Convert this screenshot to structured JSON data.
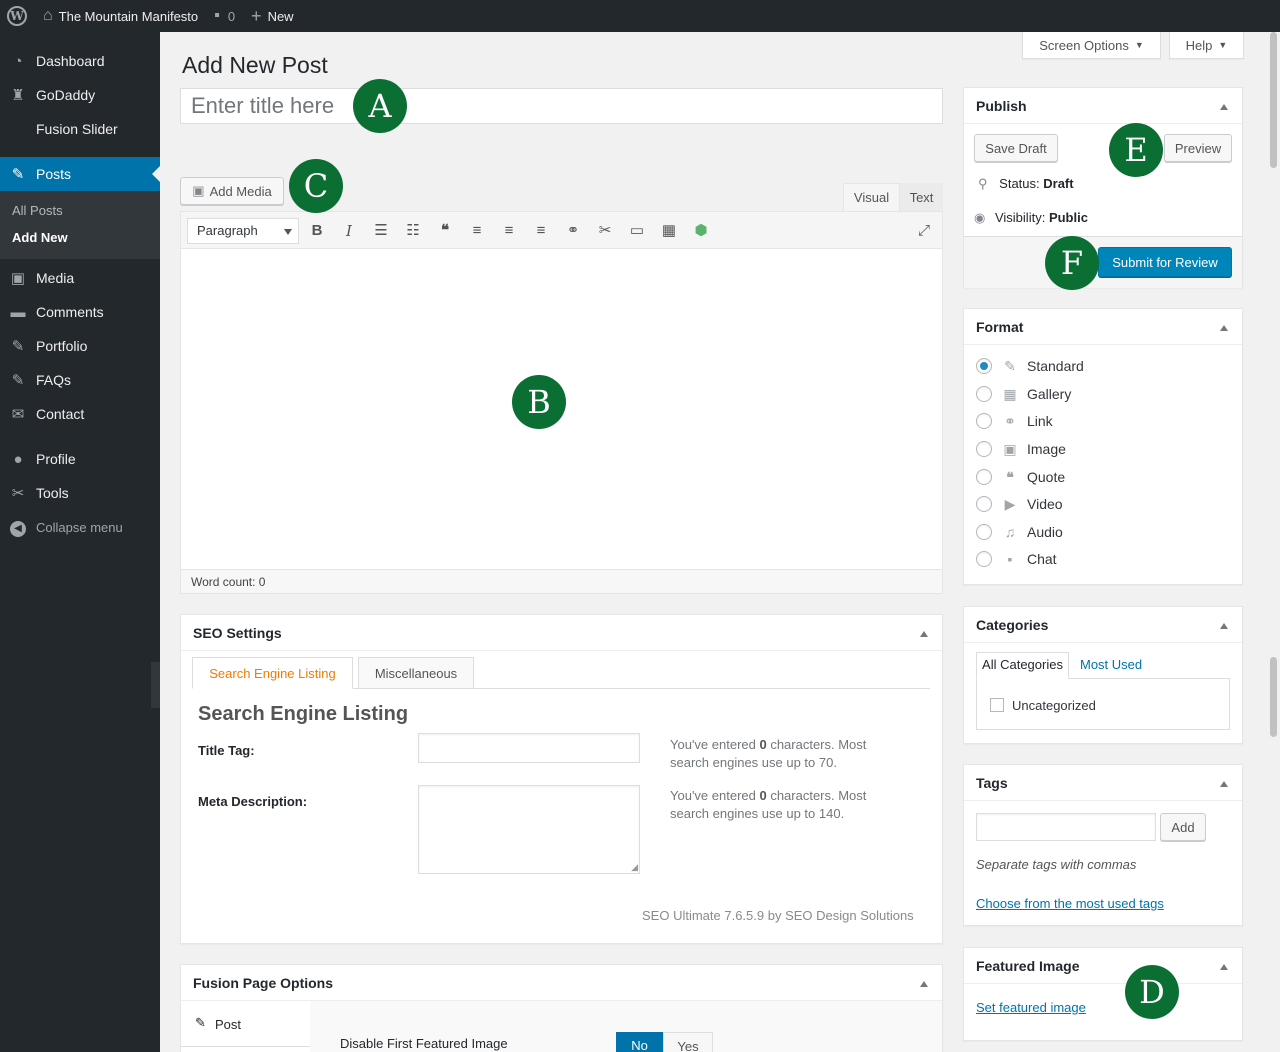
{
  "adminbar": {
    "site_name": "The Mountain Manifesto",
    "comments_count": "0",
    "new_label": "New"
  },
  "sidebar": {
    "items": [
      {
        "label": "Dashboard",
        "icon": "dashboard-icon"
      },
      {
        "label": "GoDaddy",
        "icon": "godaddy-icon"
      },
      {
        "label": "Fusion Slider",
        "icon": ""
      },
      {
        "label": "Posts",
        "icon": "pin-icon"
      },
      {
        "label": "Media",
        "icon": "media-icon"
      },
      {
        "label": "Comments",
        "icon": "comment-icon"
      },
      {
        "label": "Portfolio",
        "icon": "pin-icon"
      },
      {
        "label": "FAQs",
        "icon": "pin-icon"
      },
      {
        "label": "Contact",
        "icon": "mail-icon"
      },
      {
        "label": "Profile",
        "icon": "user-icon"
      },
      {
        "label": "Tools",
        "icon": "wrench-icon"
      },
      {
        "label": "Collapse menu",
        "icon": "collapse-icon"
      }
    ],
    "submenu": [
      "All Posts",
      "Add New"
    ]
  },
  "screen_options_label": "Screen Options",
  "help_label": "Help",
  "page_title": "Add New Post",
  "title_placeholder": "Enter title here",
  "add_media_label": "Add Media",
  "editor": {
    "tab_visual": "Visual",
    "tab_text": "Text",
    "format_select": "Paragraph",
    "word_count": "Word count: 0"
  },
  "publish": {
    "title": "Publish",
    "save_draft": "Save Draft",
    "preview": "Preview",
    "status_label": "Status:",
    "status_value": "Draft",
    "visibility_label": "Visibility:",
    "visibility_value": "Public",
    "submit": "Submit for Review"
  },
  "format": {
    "title": "Format",
    "options": [
      "Standard",
      "Gallery",
      "Link",
      "Image",
      "Quote",
      "Video",
      "Audio",
      "Chat"
    ],
    "selected": "Standard"
  },
  "categories": {
    "title": "Categories",
    "tab_all": "All Categories",
    "tab_most": "Most Used",
    "items": [
      "Uncategorized"
    ]
  },
  "tags": {
    "title": "Tags",
    "add": "Add",
    "hint": "Separate tags with commas",
    "choose_link": "Choose from the most used tags"
  },
  "featured": {
    "title": "Featured Image",
    "set_link": "Set featured image"
  },
  "seo": {
    "title": "SEO Settings",
    "tab_listing": "Search Engine Listing",
    "tab_misc": "Miscellaneous",
    "heading": "Search Engine Listing",
    "title_tag_label": "Title Tag:",
    "meta_desc_label": "Meta Description:",
    "title_hint_a": "You've entered ",
    "title_hint_count": "0",
    "title_hint_b": " characters. Most",
    "title_hint_c": "search engines use up to 70.",
    "meta_hint_a": "You've entered ",
    "meta_hint_count": "0",
    "meta_hint_b": " characters. Most",
    "meta_hint_c": "search engines use up to 140.",
    "footer": "SEO Ultimate 7.6.5.9 by SEO Design Solutions"
  },
  "fusion": {
    "title": "Fusion Page Options",
    "tab_post": "Post",
    "disable_label": "Disable First Featured Image",
    "no": "No",
    "yes": "Yes"
  },
  "markers": [
    "A",
    "B",
    "C",
    "D",
    "E",
    "F"
  ]
}
